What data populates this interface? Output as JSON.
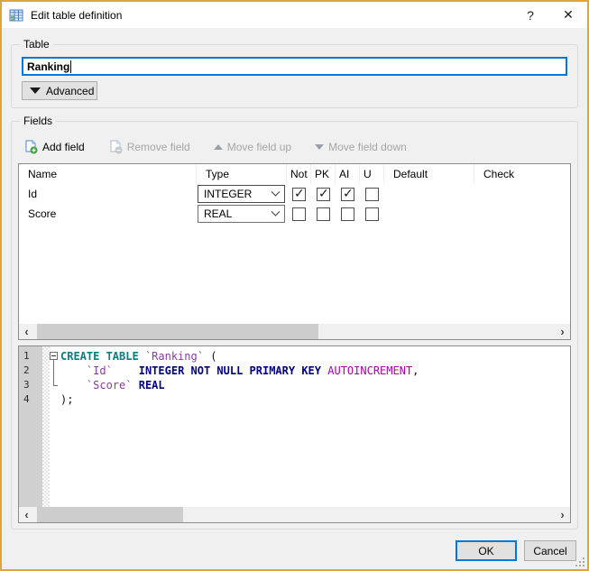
{
  "window": {
    "title": "Edit table definition",
    "help_glyph": "?",
    "close_glyph": "✕"
  },
  "table_group": {
    "label": "Table",
    "name_value": "Ranking",
    "advanced_label": "Advanced"
  },
  "fields_group": {
    "label": "Fields",
    "toolbar": {
      "add": "Add field",
      "remove": "Remove field",
      "move_up": "Move field up",
      "move_down": "Move field down"
    },
    "columns": [
      "Name",
      "Type",
      "Not",
      "PK",
      "AI",
      "U",
      "Default",
      "Check"
    ],
    "rows": [
      {
        "name": "Id",
        "type": "INTEGER",
        "not": true,
        "pk": true,
        "ai": true,
        "u": false,
        "default": "",
        "check": ""
      },
      {
        "name": "Score",
        "type": "REAL",
        "not": false,
        "pk": false,
        "ai": false,
        "u": false,
        "default": "",
        "check": ""
      }
    ]
  },
  "sql": {
    "line_numbers": [
      "1",
      "2",
      "3",
      "4"
    ],
    "lines": [
      [
        [
          "kw2",
          "CREATE TABLE"
        ],
        [
          "pl",
          " "
        ],
        [
          "id",
          "`Ranking`"
        ],
        [
          "pl",
          " ("
        ]
      ],
      [
        [
          "pl",
          "    "
        ],
        [
          "id",
          "`Id`"
        ],
        [
          "pl",
          "    "
        ],
        [
          "kw",
          "INTEGER NOT NULL PRIMARY KEY"
        ],
        [
          "pl",
          " "
        ],
        [
          "kw3",
          "AUTOINCREMENT"
        ],
        [
          "pl",
          ","
        ]
      ],
      [
        [
          "pl",
          "    "
        ],
        [
          "id",
          "`Score`"
        ],
        [
          "pl",
          " "
        ],
        [
          "kw",
          "REAL"
        ]
      ],
      [
        [
          "pl",
          ");"
        ]
      ]
    ]
  },
  "scrollbars": {
    "left_glyph": "‹",
    "right_glyph": "›",
    "fields_thumb_pct": 54,
    "sql_thumb_pct": 28
  },
  "buttons": {
    "ok": "OK",
    "cancel": "Cancel"
  },
  "colors": {
    "accent_border": "#E2A33C",
    "focus_blue": "#0078D7",
    "keyword": "#000080",
    "keyword_create": "#008080",
    "identifier": "#883C9E",
    "autoincrement": "#A500A5"
  }
}
